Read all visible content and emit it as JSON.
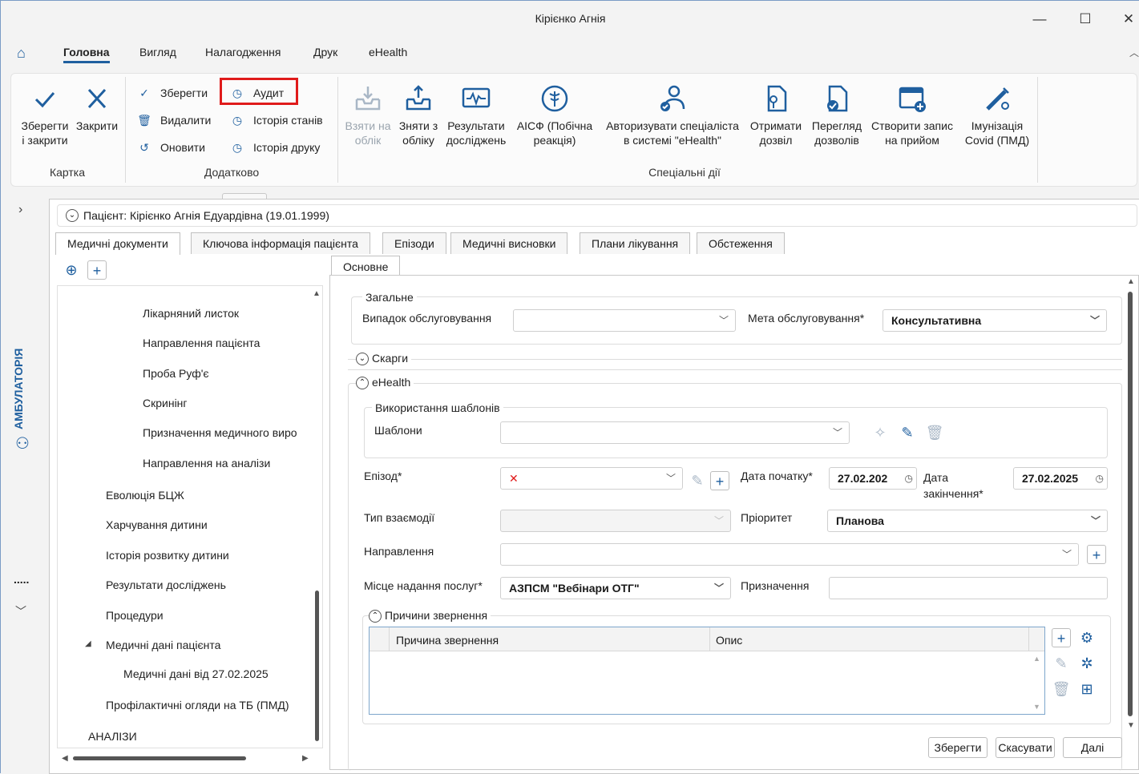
{
  "window": {
    "title": "Кірієнко Агнія"
  },
  "menu": {
    "items": [
      "Головна",
      "Вигляд",
      "Налагодження",
      "Друк",
      "eHealth"
    ]
  },
  "ribbon": {
    "card": {
      "save_close": [
        "Зберегти",
        "і закрити"
      ],
      "close": "Закрити",
      "group": "Картка"
    },
    "extra": {
      "save": "Зберегти",
      "delete": "Видалити",
      "refresh": "Оновити",
      "audit": "Аудит",
      "state_history": "Історія станів",
      "print_history": "Історія друку",
      "group": "Додатково"
    },
    "special": {
      "take": [
        "Взяти на",
        "облік"
      ],
      "remove": [
        "Зняти з",
        "обліку"
      ],
      "results": [
        "Результати",
        "досліджень"
      ],
      "aisf": [
        "АІСФ (Побічна",
        "реакція)"
      ],
      "authorize": [
        "Авторизувати спеціаліста",
        "в системі \"eHealth\""
      ],
      "get_permit": [
        "Отримати",
        "дозвіл"
      ],
      "view_permits": [
        "Перегляд",
        "дозволів"
      ],
      "create_appt": [
        "Створити запис",
        "на прийом"
      ],
      "covid": [
        "Імунізація",
        "Covid (ПМД)"
      ],
      "group": "Спеціальні дії"
    }
  },
  "tooltip": "Аудит",
  "sidebar": {
    "label": "АМБУЛАТОРІЯ",
    "dots": "....."
  },
  "patient": {
    "header": "Пацієнт: Кірієнко Агнія Едуардівна (19.01.1999)"
  },
  "tabs": [
    "Медичні документи",
    "Ключова інформація пацієнта",
    "Епізоди",
    "Медичні висновки",
    "Плани лікування",
    "Обстеження"
  ],
  "tree": {
    "items": [
      "Лікарняний листок",
      "Направлення пацієнта",
      "Проба Руф'є",
      "Скринінг",
      "Призначення медичного виро",
      "Направлення на аналізи",
      "Еволюція БЦЖ",
      "Харчування дитини",
      "Історія розвитку дитини",
      "Результати досліджень",
      "Процедури",
      "Медичні дані пацієнта",
      "Медичні дані від 27.02.2025",
      "Профілактичні огляди на ТБ (ПМД)",
      "АНАЛІЗИ"
    ]
  },
  "form": {
    "tab": "Основне",
    "general": "Загальне",
    "case_label": "Випадок обслуговування",
    "goal_label": "Мета обслуговування*",
    "goal_value": "Консультативна",
    "complaints": "Скарги",
    "ehealth": "eHealth",
    "templates_group": "Використання шаблонів",
    "templates_label": "Шаблони",
    "episode_label": "Епізод*",
    "start_label": "Дата початку*",
    "start_value": "27.02.202",
    "end_label": [
      "Дата",
      "закінчення*"
    ],
    "end_value": "27.02.2025",
    "interaction_label": "Тип взаємодії",
    "priority_label": "Пріоритет",
    "priority_value": "Планова",
    "referral_label": "Направлення",
    "place_label": "Місце надання послуг*",
    "place_value": "АЗПСМ \"Вебінари ОТГ\"",
    "purpose_label": "Призначення",
    "reasons_group": "Причини звернення",
    "col_reason": "Причина звернення",
    "col_desc": "Опис"
  },
  "buttons": {
    "save": "Зберегти",
    "cancel": "Скасувати",
    "next": "Далі"
  }
}
